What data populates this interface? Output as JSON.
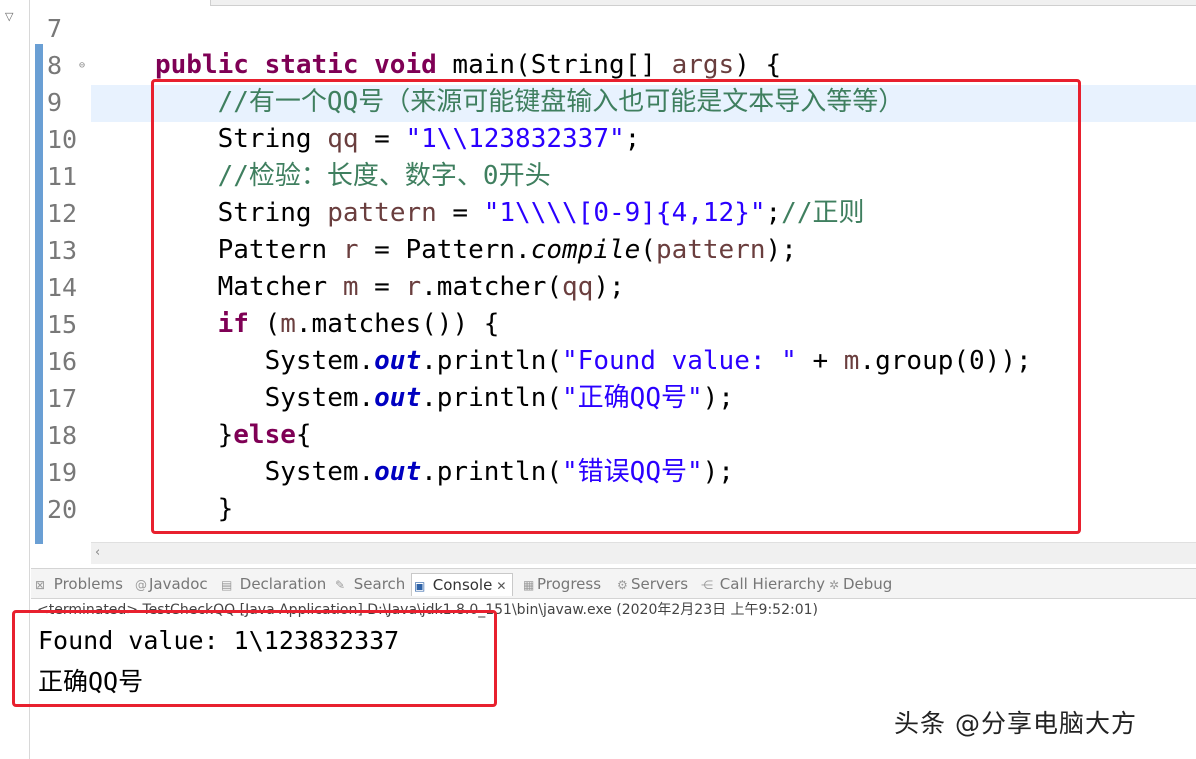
{
  "editor": {
    "line_numbers": [
      "7",
      "8",
      "9",
      "10",
      "11",
      "12",
      "13",
      "14",
      "15",
      "16",
      "17",
      "18",
      "19",
      "20"
    ],
    "code": {
      "l8_pre": "public static void ",
      "l8_post": "main(String[] ",
      "l8_arg": "args",
      "l8_end": ") {",
      "l9": "//有一个QQ号（来源可能键盘输入也可能是文本导入等等）",
      "l10_type": "String ",
      "l10_var": "qq",
      "l10_eq": " = ",
      "l10_str": "\"1\\\\123832337\"",
      "l10_end": ";",
      "l11": "//检验：长度、数字、0开头",
      "l12_type": "String ",
      "l12_var": "pattern",
      "l12_eq": " = ",
      "l12_str": "\"1\\\\\\\\[0-9]{4,12}\"",
      "l12_semi": ";",
      "l12_cm": "//正则",
      "l13_type": "Pattern ",
      "l13_var": "r",
      "l13_eq": " = Pattern.",
      "l13_fn": "compile",
      "l13_open": "(",
      "l13_arg": "pattern",
      "l13_end": ");",
      "l14_type": "Matcher ",
      "l14_var": "m",
      "l14_eq": " = ",
      "l14_obj": "r",
      "l14_call": ".matcher(",
      "l14_arg": "qq",
      "l14_end": ");",
      "l15_kw": "if",
      "l15_open": " (",
      "l15_obj": "m",
      "l15_end": ".matches()) {",
      "l16_sys": "System.",
      "l16_out": "out",
      "l16_call": ".println(",
      "l16_str": "\"Found value: \"",
      "l16_plus": " + ",
      "l16_obj": "m",
      "l16_end": ".group(0));",
      "l17_sys": "System.",
      "l17_out": "out",
      "l17_call": ".println(",
      "l17_str": "\"正确QQ号\"",
      "l17_end": ");",
      "l18_brace": "}",
      "l18_kw": "else",
      "l18_end": "{",
      "l19_sys": "System.",
      "l19_out": "out",
      "l19_call": ".println(",
      "l19_str": "\"错误QQ号\"",
      "l19_end": ");",
      "l20": "}"
    }
  },
  "views": {
    "tabs": [
      {
        "label": "Problems",
        "icon": "problems-icon"
      },
      {
        "label": "Javadoc",
        "icon": "javadoc-icon"
      },
      {
        "label": "Declaration",
        "icon": "declaration-icon"
      },
      {
        "label": "Search",
        "icon": "search-icon"
      },
      {
        "label": "Console",
        "icon": "console-icon"
      },
      {
        "label": "Progress",
        "icon": "progress-icon"
      },
      {
        "label": "Servers",
        "icon": "servers-icon"
      },
      {
        "label": "Call Hierarchy",
        "icon": "call-hierarchy-icon"
      },
      {
        "label": "Debug",
        "icon": "debug-icon"
      }
    ],
    "active": "Console",
    "close_glyph": "✕"
  },
  "console": {
    "status": "<terminated> TestCheckQQ [Java Application] D:\\Java\\jdk1.8.0_151\\bin\\javaw.exe (2020年2月23日 上午9:52:01)",
    "lines": [
      "Found value: 1\\123832337",
      "正确QQ号"
    ]
  },
  "watermark": "头条 @分享电脑大方",
  "colors": {
    "keyword": "#7f0055",
    "comment": "#3f7f5f",
    "string": "#2a00ff",
    "local_var": "#6a3e3e",
    "field": "#0000c0",
    "highlight_box": "#e8202e",
    "current_line": "#e8f2fe"
  }
}
